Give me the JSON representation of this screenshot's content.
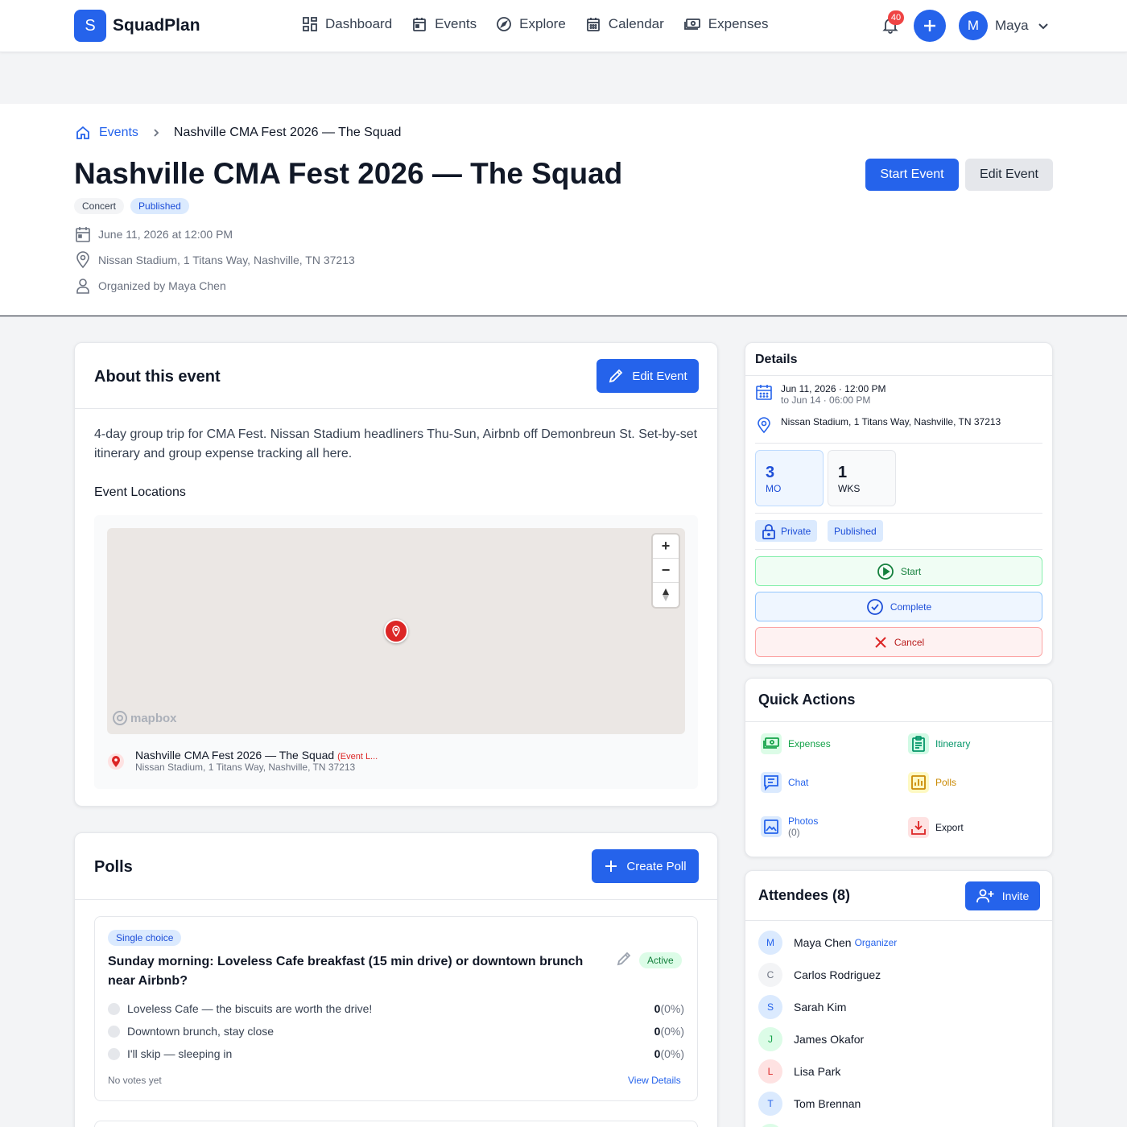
{
  "nav": {
    "brand_letter": "S",
    "brand_name": "SquadPlan",
    "links": [
      {
        "label": "Dashboard",
        "icon": "dashboard-icon"
      },
      {
        "label": "Events",
        "icon": "events-icon"
      },
      {
        "label": "Explore",
        "icon": "compass-icon"
      },
      {
        "label": "Calendar",
        "icon": "calendar-icon"
      },
      {
        "label": "Expenses",
        "icon": "money-icon"
      }
    ],
    "notification_count": "40",
    "user_initial": "M",
    "user_name": "Maya"
  },
  "header": {
    "breadcrumb_root": "Events",
    "breadcrumb_current": "Nashville CMA Fest 2026 — The Squad",
    "title": "Nashville CMA Fest 2026 — The Squad",
    "tags": [
      "Concert",
      "Published"
    ],
    "date": "June 11, 2026 at 12:00 PM",
    "location": "Nissan Stadium, 1 Titans Way, Nashville, TN 37213",
    "organizer": "Organized by Maya Chen",
    "start_button": "Start Event",
    "edit_button": "Edit Event"
  },
  "about": {
    "title": "About this event",
    "edit_button": "Edit Event",
    "description": "4-day group trip for CMA Fest. Nissan Stadium headliners Thu-Sun, Airbnb off Demonbreun St. Set-by-set itinerary and group expense tracking all here.",
    "locations_title": "Event Locations",
    "map_attribution": "mapbox",
    "location_name": "Nashville CMA Fest 2026 — The Squad",
    "location_tag": "(Event L...",
    "location_address": "Nissan Stadium, 1 Titans Way, Nashville, TN 37213"
  },
  "polls": {
    "title": "Polls",
    "create_button": "Create Poll",
    "items": [
      {
        "type": "Single choice",
        "question": "Sunday morning: Loveless Cafe breakfast (15 min drive) or downtown brunch near Airbnb?",
        "status": "Active",
        "options": [
          {
            "label": "Loveless Cafe — the biscuits are worth the drive!",
            "count": "0",
            "percent": "(0%)"
          },
          {
            "label": "Downtown brunch, stay close",
            "count": "0",
            "percent": "(0%)"
          },
          {
            "label": "I'll skip — sleeping in",
            "count": "0",
            "percent": "(0%)"
          }
        ],
        "footer": "No votes yet",
        "link": "View Details"
      }
    ]
  },
  "details": {
    "title": "Details",
    "date_start": "Jun 11, 2026 · 12:00 PM",
    "date_end": "to Jun 14 · 06:00 PM",
    "location": "Nissan Stadium, 1 Titans Way, Nashville, TN 37213",
    "countdown": [
      {
        "value": "3",
        "label": "MO"
      },
      {
        "value": "1",
        "label": "WKS"
      }
    ],
    "privacy": "Private",
    "status": "Published",
    "start_label": "Start",
    "complete_label": "Complete",
    "cancel_label": "Cancel"
  },
  "quick_actions": {
    "title": "Quick Actions",
    "items": [
      {
        "label": "Expenses",
        "color": "#16a34a"
      },
      {
        "label": "Itinerary",
        "color": "#059669"
      },
      {
        "label": "Chat",
        "color": "#2563eb"
      },
      {
        "label": "Polls",
        "color": "#ca8a04"
      },
      {
        "label": "Photos",
        "count": "(0)",
        "color": "#2563eb"
      },
      {
        "label": "Export",
        "color": "#dc2626"
      }
    ]
  },
  "attendees": {
    "title": "Attendees (8)",
    "invite_button": "Invite",
    "list": [
      {
        "initial": "M",
        "name": "Maya Chen",
        "role": "Organizer"
      },
      {
        "initial": "C",
        "name": "Carlos Rodriguez"
      },
      {
        "initial": "S",
        "name": "Sarah Kim"
      },
      {
        "initial": "J",
        "name": "James Okafor"
      },
      {
        "initial": "L",
        "name": "Lisa Park"
      },
      {
        "initial": "T",
        "name": "Tom Brennan"
      }
    ]
  }
}
